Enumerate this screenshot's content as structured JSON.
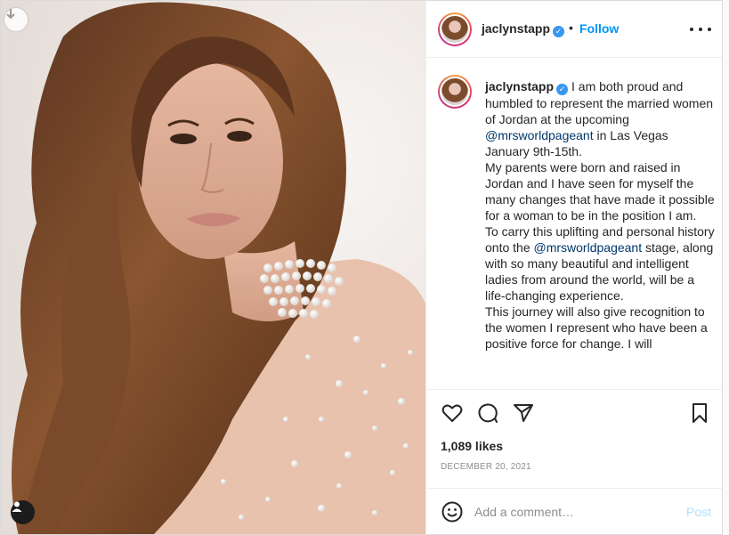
{
  "post": {
    "username": "jaclynstapp",
    "follow_label": "Follow",
    "separator": "•",
    "caption_parts": {
      "p1": "I am both proud and humbled to represent the married women of Jordan at the upcoming ",
      "mention1": "@mrsworldpageant",
      "p2": " in Las Vegas January 9th-15th.",
      "p3": "My parents were born and raised in Jordan and I have seen for myself the many changes that have made it possible for a woman to be in the position I am.",
      "p4a": "To carry this uplifting and personal history onto the ",
      "mention2": "@mrsworldpageant",
      "p4b": " stage, along with so many beautiful and intelligent ladies from around the world, will be a life-changing experience.",
      "p5": "This journey will also give recognition to the women I represent who have been a positive force for change. I will"
    },
    "likes": "1,089 likes",
    "date": "DECEMBER 20, 2021",
    "comment_placeholder": "Add a comment…",
    "post_label": "Post"
  },
  "colors": {
    "accent": "#0095f6",
    "mention": "#00376b",
    "verified": "#3897f0",
    "post_disabled": "#b2dffc"
  },
  "icons": {
    "download": "arrow-down-icon",
    "tag": "user-tag-icon",
    "verified": "verified-badge-icon",
    "more": "more-options-icon",
    "like": "heart-icon",
    "comment": "comment-bubble-icon",
    "share": "paper-plane-icon",
    "save": "bookmark-icon",
    "emoji": "smiley-icon"
  }
}
